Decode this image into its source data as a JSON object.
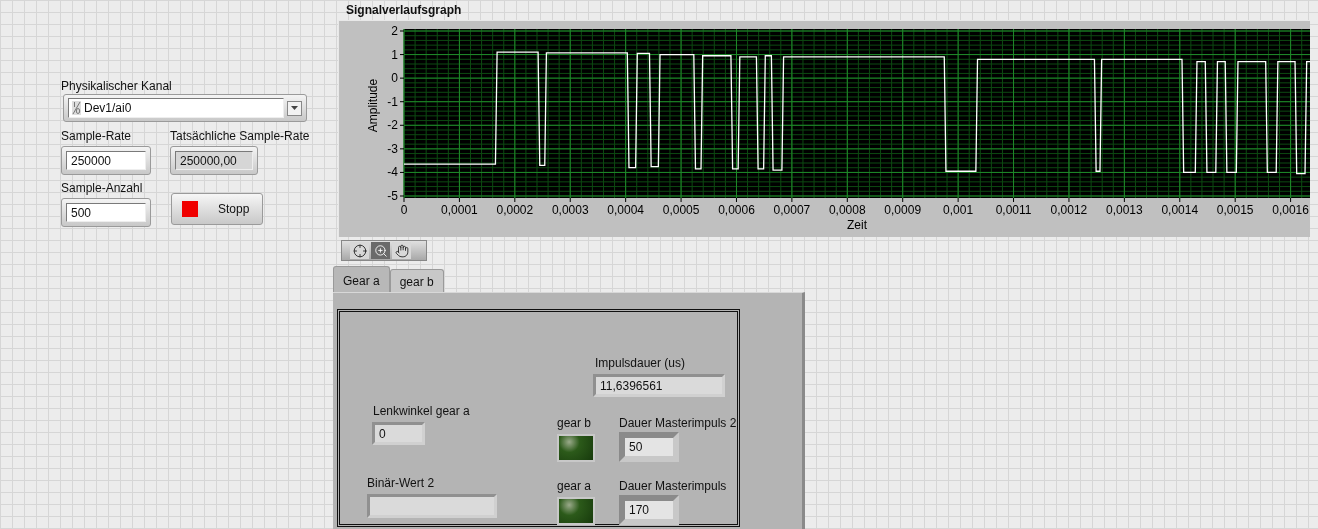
{
  "channel": {
    "label": "Physikalischer Kanal",
    "value": "Dev1/ai0"
  },
  "fields": [
    {
      "label": "Sample-Rate",
      "value": "250000",
      "kind": "control"
    },
    {
      "label": "Tatsächliche Sample-Rate",
      "value": "250000,00",
      "kind": "indicator"
    },
    {
      "label": "Sample-Anzahl",
      "value": "500",
      "kind": "control"
    }
  ],
  "stop_button": {
    "label": "Stopp",
    "on": true
  },
  "graph": {
    "chart_data": {
      "type": "line",
      "title": "Signalverlaufsgraph",
      "xlabel": "Zeit",
      "ylabel": "Amplitude",
      "x": [
        0,
        0.000165,
        0.000168,
        0.000242,
        0.000245,
        0.000254,
        0.000257,
        0.000403,
        0.000406,
        0.000418,
        0.000421,
        0.000443,
        0.000446,
        0.000459,
        0.000462,
        0.000523,
        0.000526,
        0.000536,
        0.000539,
        0.00059,
        0.000593,
        0.000603,
        0.000606,
        0.000636,
        0.000639,
        0.000649,
        0.000652,
        0.000663,
        0.000666,
        0.000682,
        0.000685,
        0.000975,
        0.000978,
        0.001032,
        0.001035,
        0.001246,
        0.001249,
        0.001256,
        0.001259,
        0.001404,
        0.001407,
        0.001428,
        0.001431,
        0.001446,
        0.001449,
        0.001465,
        0.001468,
        0.001482,
        0.001485,
        0.001502,
        0.001505,
        0.001555,
        0.001558,
        0.001574,
        0.001577,
        0.001608,
        0.001611,
        0.001626,
        0.001629,
        0.001635
      ],
      "series": [
        {
          "color": "#ffffff",
          "values": [
            -3.65,
            -3.65,
            1.1,
            1.1,
            -3.7,
            -3.7,
            1.07,
            1.07,
            -3.8,
            -3.8,
            1.05,
            1.05,
            -3.75,
            -3.75,
            1.0,
            1.0,
            -3.85,
            -3.85,
            0.95,
            0.95,
            -3.85,
            -3.85,
            0.9,
            0.9,
            -3.85,
            -3.85,
            0.95,
            0.95,
            -3.9,
            -3.9,
            0.9,
            0.9,
            -3.95,
            -3.95,
            0.8,
            0.8,
            -3.95,
            -3.95,
            0.8,
            0.8,
            -4.0,
            -4.0,
            0.7,
            0.7,
            -4.0,
            -4.0,
            0.7,
            0.7,
            -4.0,
            -4.0,
            0.7,
            0.7,
            -4.0,
            -4.0,
            0.7,
            0.7,
            -4.05,
            -4.05,
            0.7,
            0.7
          ]
        }
      ],
      "xlim": [
        0,
        0.001635
      ],
      "ylim": [
        -5,
        2
      ],
      "grid": true,
      "xticks": [
        {
          "value": 0,
          "label": "0"
        },
        {
          "value": 0.0001,
          "label": "0,0001"
        },
        {
          "value": 0.0002,
          "label": "0,0002"
        },
        {
          "value": 0.0003,
          "label": "0,0003"
        },
        {
          "value": 0.0004,
          "label": "0,0004"
        },
        {
          "value": 0.0005,
          "label": "0,0005"
        },
        {
          "value": 0.0006,
          "label": "0,0006"
        },
        {
          "value": 0.0007,
          "label": "0,0007"
        },
        {
          "value": 0.0008,
          "label": "0,0008"
        },
        {
          "value": 0.0009,
          "label": "0,0009"
        },
        {
          "value": 0.001,
          "label": "0,001"
        },
        {
          "value": 0.0011,
          "label": "0,0011"
        },
        {
          "value": 0.0012,
          "label": "0,0012"
        },
        {
          "value": 0.0013,
          "label": "0,0013"
        },
        {
          "value": 0.0014,
          "label": "0,0014"
        },
        {
          "value": 0.0015,
          "label": "0,0015"
        },
        {
          "value": 0.0016,
          "label": "0,0016"
        }
      ],
      "yticks": [
        -5,
        -4,
        -3,
        -2,
        -1,
        0,
        1,
        2
      ]
    }
  },
  "graph_palette": [
    {
      "kind": "cursor",
      "selected": false
    },
    {
      "kind": "zoom",
      "selected": true
    },
    {
      "kind": "pan",
      "selected": false
    }
  ],
  "tabs": [
    {
      "label": "Gear a",
      "selected": true
    },
    {
      "label": "gear b",
      "selected": false
    }
  ],
  "tab_content": {
    "impulsdauer": {
      "label": "Impulsdauer (us)",
      "value": "11,6396561"
    },
    "lenkwinkel": {
      "label": "Lenkwinkel gear a",
      "value": "0"
    },
    "binaer_wert": {
      "label": "Binär-Wert 2"
    },
    "leds": [
      {
        "label": "gear b",
        "on": false
      },
      {
        "label": "gear a",
        "on": false
      }
    ],
    "master": [
      {
        "label": "Dauer Masterimpuls 2",
        "value": "50"
      },
      {
        "label": "Dauer Masterimpuls",
        "value": "170"
      }
    ]
  }
}
